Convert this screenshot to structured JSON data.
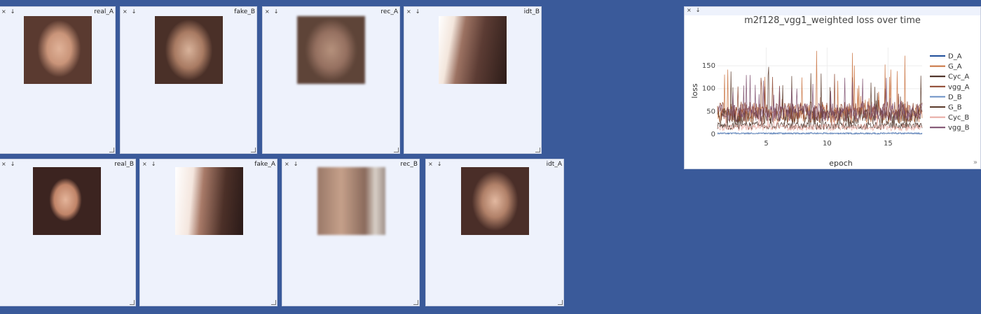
{
  "panes": [
    {
      "title": "real_A",
      "close": "×",
      "download": "↓"
    },
    {
      "title": "fake_B",
      "close": "×",
      "download": "↓"
    },
    {
      "title": "rec_A",
      "close": "×",
      "download": "↓"
    },
    {
      "title": "idt_B",
      "close": "×",
      "download": "↓"
    },
    {
      "title": "real_B",
      "close": "×",
      "download": "↓"
    },
    {
      "title": "fake_A",
      "close": "×",
      "download": "↓"
    },
    {
      "title": "rec_B",
      "close": "×",
      "download": "↓"
    },
    {
      "title": "idt_A",
      "close": "×",
      "download": "↓"
    }
  ],
  "plot_pane": {
    "close": "×",
    "download": "↓",
    "expand": "»"
  },
  "chart_data": {
    "type": "line",
    "title": "m2f128_vgg1_weighted loss over time",
    "xlabel": "epoch",
    "ylabel": "loss",
    "xticks": [
      5,
      10,
      15
    ],
    "yticks": [
      0,
      50,
      100,
      150
    ],
    "xlim": [
      1,
      17.8
    ],
    "ylim": [
      0,
      190
    ],
    "legend_position": "right",
    "series": [
      {
        "name": "D_A",
        "color": "#1f4e9a",
        "level": 2,
        "spread": 1.5,
        "spikes": 0
      },
      {
        "name": "G_A",
        "color": "#c8703c",
        "level": 45,
        "spread": 20,
        "spikes": 185
      },
      {
        "name": "Cyc_A",
        "color": "#3c1e14",
        "level": 18,
        "spread": 8,
        "spikes": 60
      },
      {
        "name": "vgg_A",
        "color": "#8a4028",
        "level": 50,
        "spread": 22,
        "spikes": 140
      },
      {
        "name": "D_B",
        "color": "#6a8fc4",
        "level": 2,
        "spread": 1.5,
        "spikes": 0
      },
      {
        "name": "G_B",
        "color": "#5a3a2a",
        "level": 40,
        "spread": 18,
        "spikes": 150
      },
      {
        "name": "Cyc_B",
        "color": "#e8a8a0",
        "level": 15,
        "spread": 7,
        "spikes": 55
      },
      {
        "name": "vgg_B",
        "color": "#7a4a6a",
        "level": 48,
        "spread": 20,
        "spikes": 130
      }
    ]
  }
}
